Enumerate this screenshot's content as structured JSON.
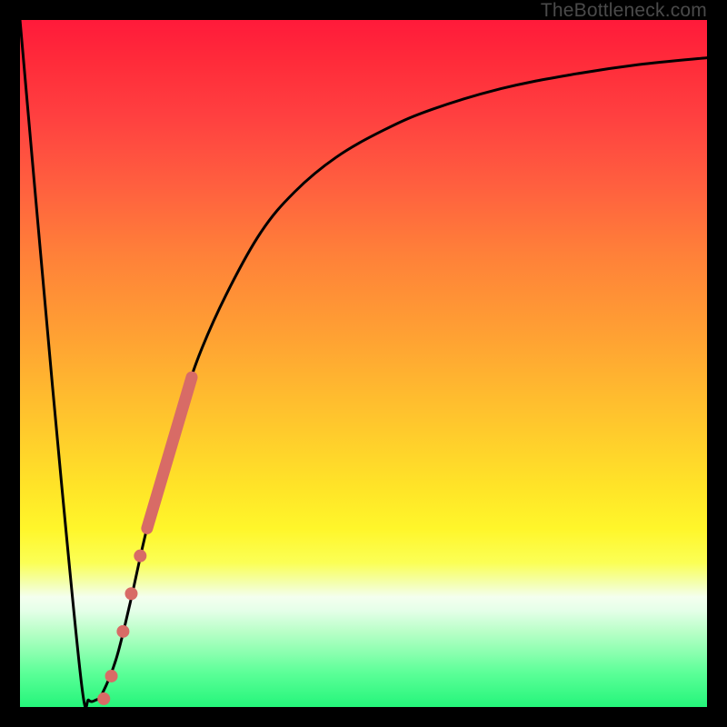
{
  "watermark": "TheBottleneck.com",
  "chart_data": {
    "type": "line",
    "title": "",
    "xlabel": "",
    "ylabel": "",
    "xlim": [
      0,
      100
    ],
    "ylim": [
      0,
      100
    ],
    "background_gradient": {
      "orientation": "vertical",
      "stops": [
        {
          "pos": 0,
          "color": "#ff1a3a"
        },
        {
          "pos": 24,
          "color": "#ff5f3f"
        },
        {
          "pos": 46,
          "color": "#ffa133"
        },
        {
          "pos": 68,
          "color": "#ffe428"
        },
        {
          "pos": 84,
          "color": "#f4ffef"
        },
        {
          "pos": 100,
          "color": "#24f57a"
        }
      ]
    },
    "series": [
      {
        "name": "bottleneck-curve",
        "color": "#000000",
        "x": [
          0,
          3,
          6,
          9,
          10,
          11,
          12,
          14,
          16,
          18,
          20,
          23,
          26,
          30,
          35,
          40,
          46,
          53,
          60,
          70,
          80,
          90,
          100
        ],
        "y": [
          100,
          66,
          33,
          3,
          1,
          1,
          2,
          7,
          15,
          24,
          32,
          42,
          51,
          60,
          69,
          75,
          80,
          84,
          87,
          90,
          92,
          93.5,
          94.5
        ]
      }
    ],
    "markers": [
      {
        "name": "highlight-band",
        "color": "#d86b66",
        "type": "thick-line",
        "x": [
          18.5,
          25.0
        ],
        "y": [
          26.0,
          48.0
        ]
      },
      {
        "name": "dot-1",
        "color": "#d86b66",
        "type": "circle",
        "x": 17.5,
        "y": 22.0
      },
      {
        "name": "dot-2",
        "color": "#d86b66",
        "type": "circle",
        "x": 16.2,
        "y": 16.5
      },
      {
        "name": "dot-3",
        "color": "#d86b66",
        "type": "circle",
        "x": 15.0,
        "y": 11.0
      },
      {
        "name": "dot-4",
        "color": "#d86b66",
        "type": "circle",
        "x": 13.3,
        "y": 4.5
      },
      {
        "name": "dot-5",
        "color": "#d86b66",
        "type": "circle",
        "x": 12.2,
        "y": 1.2
      }
    ]
  }
}
